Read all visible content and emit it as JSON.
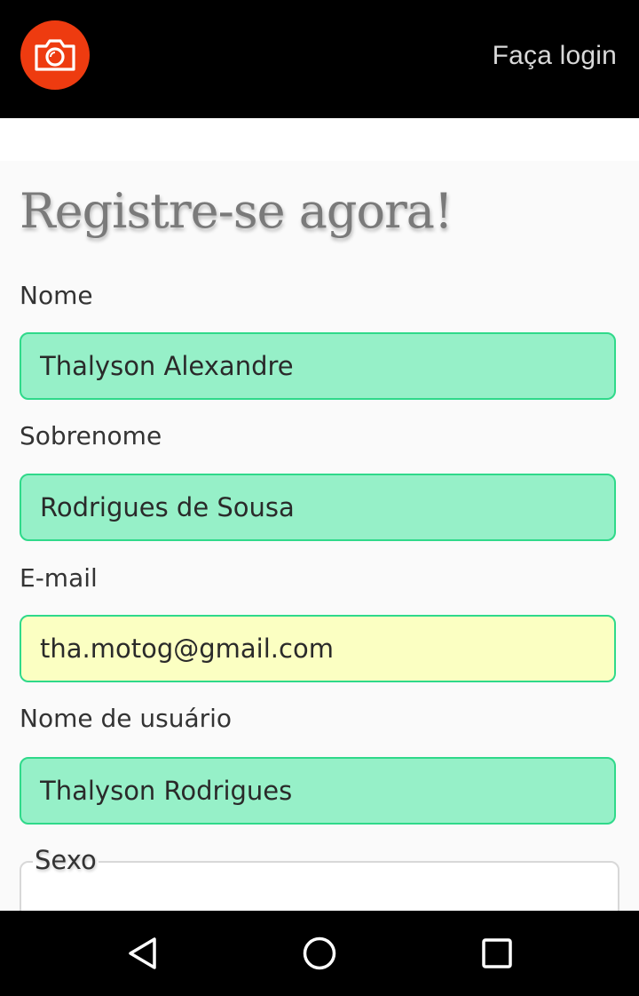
{
  "header": {
    "logo_icon": "camera-icon",
    "login_label": "Faça login",
    "brand_color": "#ee3b10"
  },
  "form": {
    "title": "Registre-se agora!",
    "fields": [
      {
        "label": "Nome",
        "value": "Thalyson Alexandre",
        "state": "valid"
      },
      {
        "label": "Sobrenome",
        "value": "Rodrigues de Sousa",
        "state": "valid"
      },
      {
        "label": "E-mail",
        "value": "tha.motog@gmail.com",
        "state": "autofill"
      },
      {
        "label": "Nome de usuário",
        "value": "Thalyson Rodrigues",
        "state": "valid"
      }
    ],
    "gender_legend": "Sexo"
  },
  "colors": {
    "valid_bg": "#96f0c8",
    "valid_border": "#2fd98a",
    "autofill_bg": "#fbffc2"
  },
  "nav": {
    "back_icon": "back-triangle-icon",
    "home_icon": "home-circle-icon",
    "recents_icon": "recents-square-icon"
  }
}
